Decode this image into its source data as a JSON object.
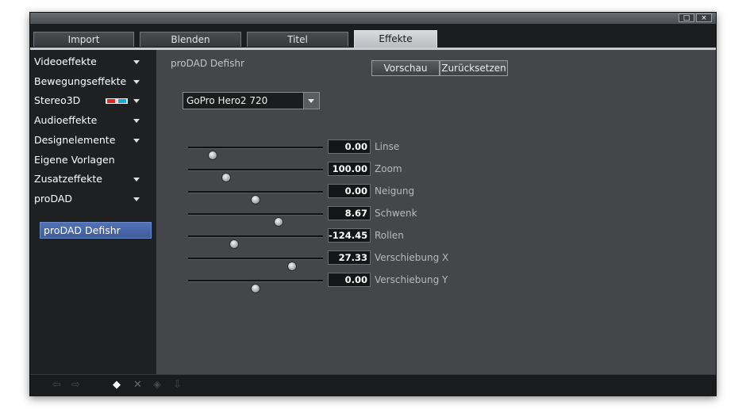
{
  "window": {
    "controls": {
      "maximize": "□",
      "close": "×"
    }
  },
  "tabs": [
    {
      "label": "Import",
      "active": false
    },
    {
      "label": "Blenden",
      "active": false
    },
    {
      "label": "Titel",
      "active": false
    },
    {
      "label": "Effekte",
      "active": true
    }
  ],
  "sidebar": {
    "items": [
      {
        "label": "Videoeffekte",
        "expandable": true
      },
      {
        "label": "Bewegungseffekte",
        "expandable": true
      },
      {
        "label": "Stereo3D",
        "expandable": true,
        "icon": "3d-glasses-icon"
      },
      {
        "label": "Audioeffekte",
        "expandable": true
      },
      {
        "label": "Designelemente",
        "expandable": true
      },
      {
        "label": "Eigene Vorlagen",
        "expandable": false
      },
      {
        "label": "Zusatzeffekte",
        "expandable": true
      },
      {
        "label": "proDAD",
        "expandable": true
      }
    ],
    "selected_subitem": {
      "label": "proDAD Defishr"
    }
  },
  "content": {
    "title": "proDAD Defishr",
    "preview_button": "Vorschau",
    "reset_button": "Zurücksetzen",
    "preset_dropdown": {
      "selected": "GoPro Hero2 720"
    },
    "sliders": [
      {
        "label": "Linse",
        "display": "0.00",
        "level": 0.18
      },
      {
        "label": "Zoom",
        "display": "100.00",
        "level": 0.28
      },
      {
        "label": "Neigung",
        "display": "0.00",
        "level": 0.5
      },
      {
        "label": "Schwenk",
        "display": "8.67",
        "level": 0.67
      },
      {
        "label": "Rollen",
        "display": "-124.45",
        "level": 0.34
      },
      {
        "label": "Verschiebung X",
        "display": "27.33",
        "level": 0.77
      },
      {
        "label": "Verschiebung Y",
        "display": "0.00",
        "level": 0.5
      }
    ]
  },
  "bottom_toolbar": {
    "icons": [
      "arrow-left-icon",
      "arrow-right-icon",
      "diamond-icon",
      "close-icon",
      "diamond-prev-icon",
      "arrow-down-icon"
    ]
  },
  "colors": {
    "accent": "#4a6bb0",
    "window_bg": "#2b2c2e",
    "content_bg": "#45464a"
  }
}
